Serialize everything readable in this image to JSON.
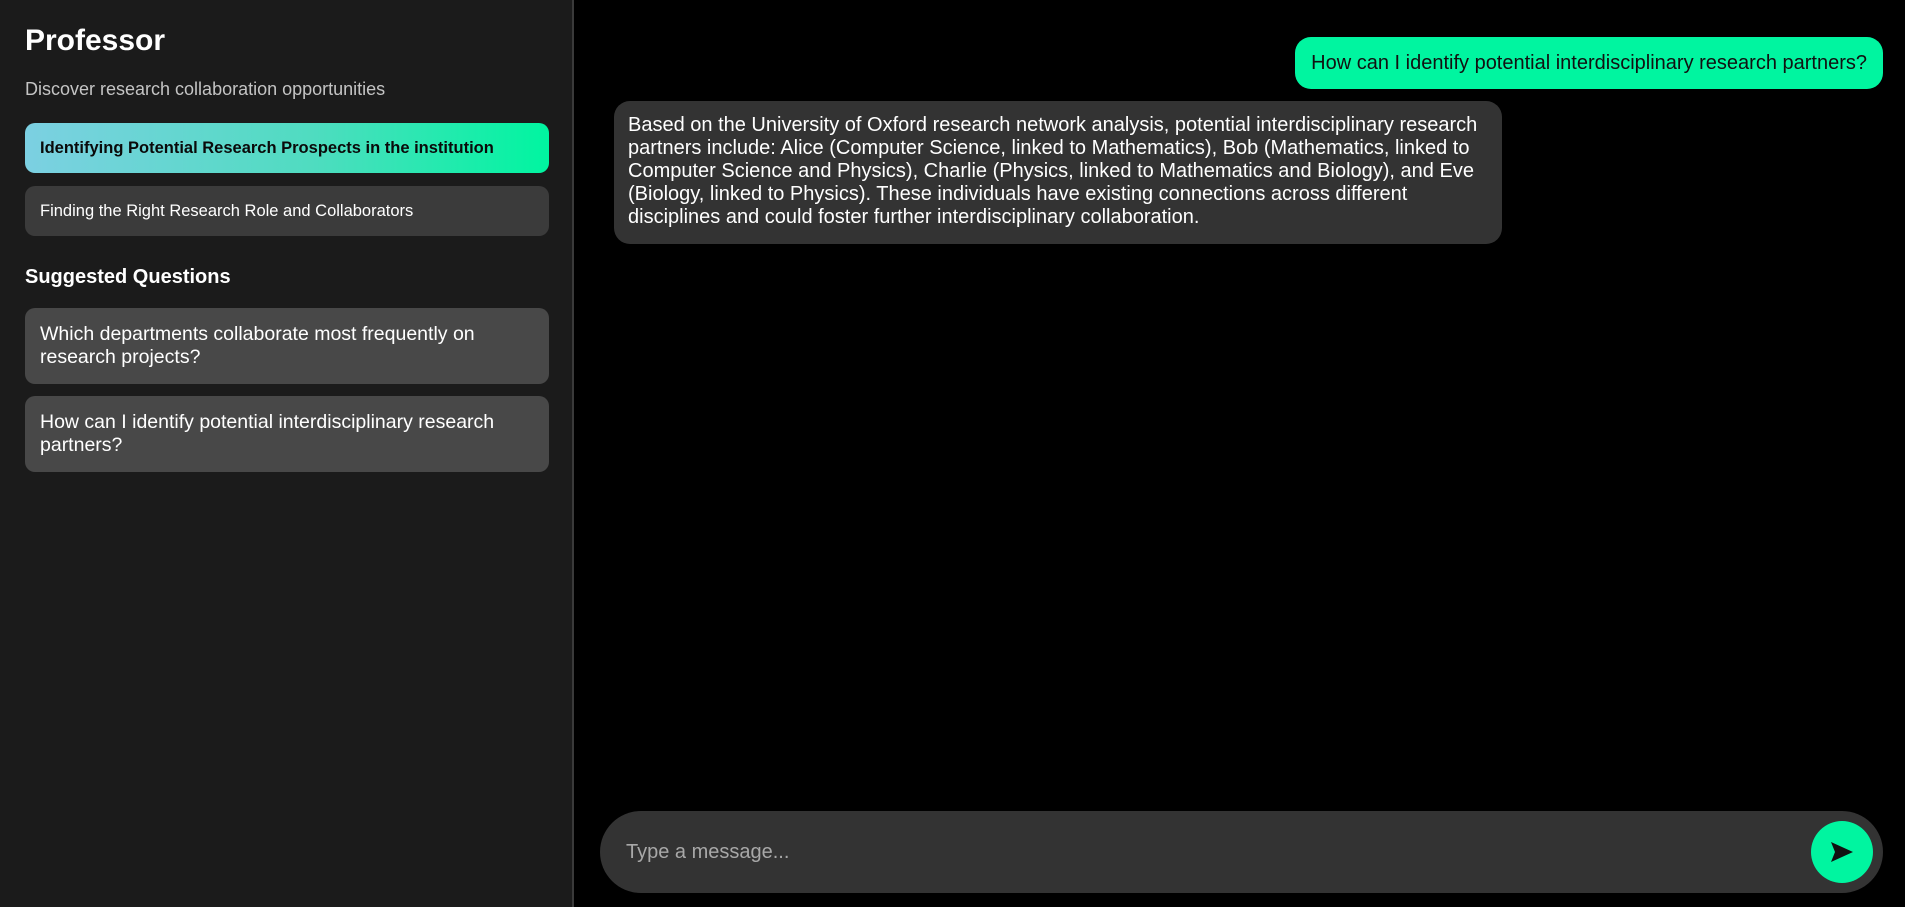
{
  "sidebar": {
    "title": "Professor",
    "subtitle": "Discover research collaboration opportunities",
    "topics": [
      {
        "label": "Identifying Potential Research Prospects in the institution",
        "active": true
      },
      {
        "label": "Finding the Right Research Role and Collaborators",
        "active": false
      }
    ],
    "suggested_heading": "Suggested Questions",
    "suggestions": [
      {
        "label": "Which departments collaborate most frequently on research projects?"
      },
      {
        "label": "How can I identify potential interdisciplinary research partners?"
      }
    ]
  },
  "chat": {
    "messages": [
      {
        "role": "user",
        "text": "How can I identify potential interdisciplinary research partners?"
      },
      {
        "role": "assistant",
        "text": "Based on the University of Oxford research network analysis, potential interdisciplinary research partners include: Alice (Computer Science, linked to Mathematics), Bob (Mathematics, linked to Computer Science and Physics), Charlie (Physics, linked to Mathematics and Biology), and Eve (Biology, linked to Physics). These individuals have existing connections across different disciplines and could foster further interdisciplinary collaboration."
      }
    ],
    "composer": {
      "placeholder": "Type a message...",
      "value": "",
      "send_icon": "send-arrow-icon"
    }
  },
  "colors": {
    "accent": "#00f5a0",
    "active_gradient_start": "#7cd0e2",
    "sidebar_bg": "#1b1b1b",
    "main_bg": "#000000",
    "bubble_bot": "#333333",
    "item_bg": "#484848"
  }
}
